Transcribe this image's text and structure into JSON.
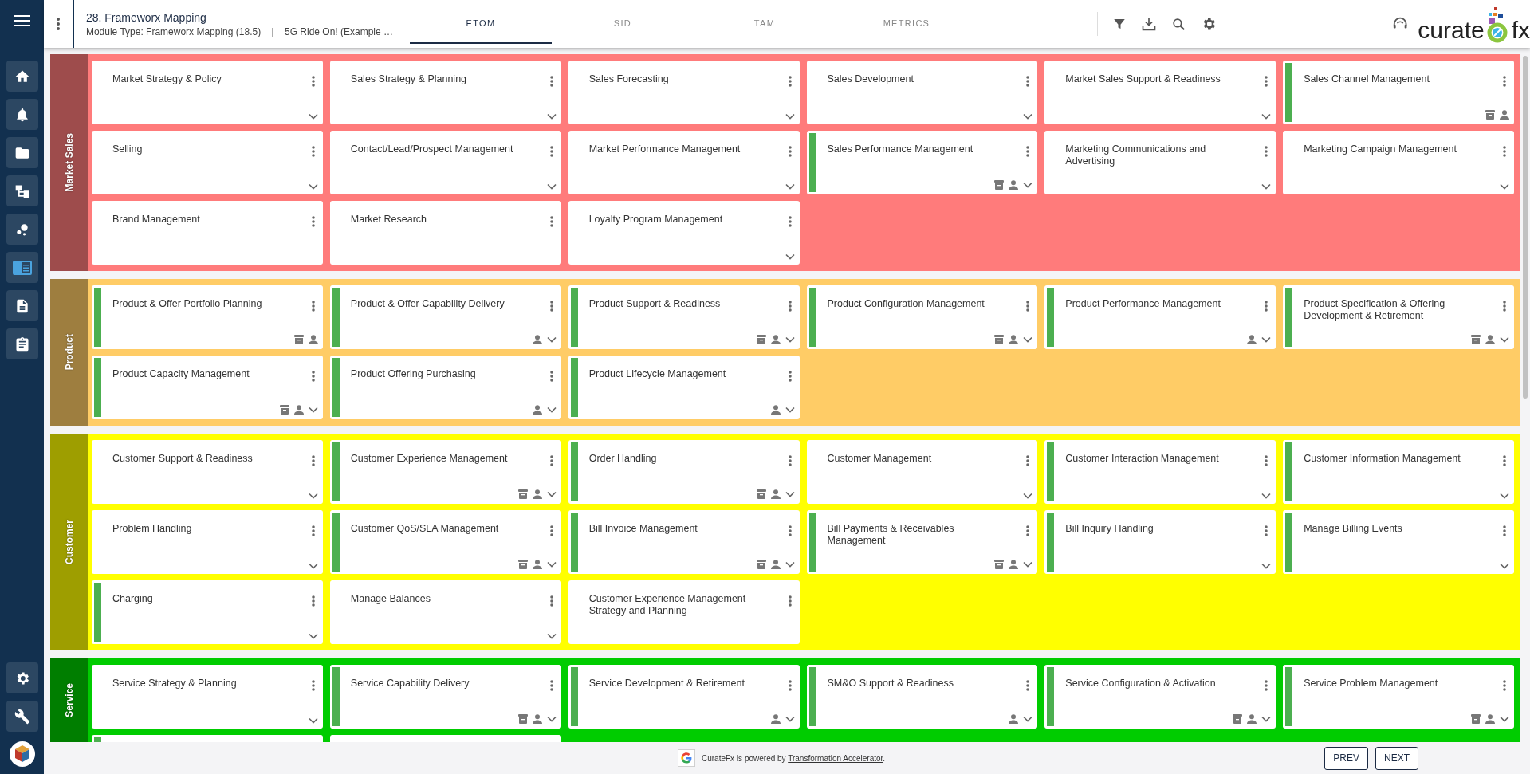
{
  "header": {
    "title": "28. Frameworx Mapping",
    "module_type": "Module Type: Frameworx Mapping (18.5)",
    "separator": "|",
    "project": "5G Ride On! (Example …",
    "logo_text": "curate",
    "logo_suffix": "fx"
  },
  "tabs": [
    {
      "label": "ETOM",
      "selected": true
    },
    {
      "label": "SID",
      "selected": false
    },
    {
      "label": "TAM",
      "selected": false
    },
    {
      "label": "METRICS",
      "selected": false
    }
  ],
  "nav": [
    {
      "selected": false
    },
    {
      "selected": false
    },
    {
      "selected": false
    },
    {
      "selected": false
    },
    {
      "selected": false
    },
    {
      "selected": true
    },
    {
      "selected": false
    },
    {
      "selected": false
    }
  ],
  "sections": [
    {
      "label": "Market Sales",
      "color": "#ff7b7b",
      "cards": [
        {
          "title": "Market Strategy & Policy",
          "mapped": false,
          "archive": false,
          "person": false,
          "expand": true
        },
        {
          "title": "Sales Strategy & Planning",
          "mapped": false,
          "archive": false,
          "person": false,
          "expand": true
        },
        {
          "title": "Sales Forecasting",
          "mapped": false,
          "archive": false,
          "person": false,
          "expand": true
        },
        {
          "title": "Sales Development",
          "mapped": false,
          "archive": false,
          "person": false,
          "expand": true
        },
        {
          "title": "Market Sales Support & Readiness",
          "mapped": false,
          "archive": false,
          "person": false,
          "expand": true
        },
        {
          "title": "Sales Channel Management",
          "mapped": true,
          "archive": true,
          "person": true,
          "expand": false
        },
        {
          "title": "Selling",
          "mapped": false,
          "archive": false,
          "person": false,
          "expand": true
        },
        {
          "title": "Contact/Lead/Prospect Management",
          "mapped": false,
          "archive": false,
          "person": false,
          "expand": true
        },
        {
          "title": "Market Performance Management",
          "mapped": false,
          "archive": false,
          "person": false,
          "expand": true
        },
        {
          "title": "Sales Performance Management",
          "mapped": true,
          "archive": true,
          "person": true,
          "expand": true
        },
        {
          "title": "Marketing Communications and Advertising",
          "mapped": false,
          "archive": false,
          "person": false,
          "expand": true
        },
        {
          "title": "Marketing Campaign Management",
          "mapped": false,
          "archive": false,
          "person": false,
          "expand": true
        },
        {
          "title": "Brand Management",
          "mapped": false,
          "archive": false,
          "person": false,
          "expand": false
        },
        {
          "title": "Market Research",
          "mapped": false,
          "archive": false,
          "person": false,
          "expand": false
        },
        {
          "title": "Loyalty Program Management",
          "mapped": false,
          "archive": false,
          "person": false,
          "expand": true
        }
      ]
    },
    {
      "label": "Product",
      "color": "#ffcc66",
      "cards": [
        {
          "title": "Product & Offer Portfolio Planning",
          "mapped": true,
          "archive": true,
          "person": true,
          "expand": false
        },
        {
          "title": "Product & Offer Capability Delivery",
          "mapped": true,
          "archive": false,
          "person": true,
          "expand": true
        },
        {
          "title": "Product Support & Readiness",
          "mapped": true,
          "archive": true,
          "person": true,
          "expand": true
        },
        {
          "title": "Product Configuration Management",
          "mapped": true,
          "archive": true,
          "person": true,
          "expand": true
        },
        {
          "title": "Product Performance Management",
          "mapped": true,
          "archive": false,
          "person": true,
          "expand": true
        },
        {
          "title": "Product Specification & Offering Development & Retirement",
          "mapped": true,
          "archive": true,
          "person": true,
          "expand": true
        },
        {
          "title": "Product Capacity Management",
          "mapped": true,
          "archive": true,
          "person": true,
          "expand": true
        },
        {
          "title": "Product Offering Purchasing",
          "mapped": true,
          "archive": false,
          "person": true,
          "expand": true
        },
        {
          "title": "Product Lifecycle Management",
          "mapped": true,
          "archive": false,
          "person": true,
          "expand": true
        }
      ]
    },
    {
      "label": "Customer",
      "color": "#ffff00",
      "cards": [
        {
          "title": "Customer Support & Readiness",
          "mapped": false,
          "archive": false,
          "person": false,
          "expand": true
        },
        {
          "title": "Customer Experience Management",
          "mapped": true,
          "archive": true,
          "person": true,
          "expand": true
        },
        {
          "title": "Order Handling",
          "mapped": true,
          "archive": true,
          "person": true,
          "expand": true
        },
        {
          "title": "Customer Management",
          "mapped": false,
          "archive": false,
          "person": false,
          "expand": true
        },
        {
          "title": "Customer Interaction Management",
          "mapped": true,
          "archive": false,
          "person": false,
          "expand": true
        },
        {
          "title": "Customer Information Management",
          "mapped": true,
          "archive": false,
          "person": false,
          "expand": true
        },
        {
          "title": "Problem Handling",
          "mapped": false,
          "archive": false,
          "person": false,
          "expand": true
        },
        {
          "title": "Customer QoS/SLA Management",
          "mapped": true,
          "archive": true,
          "person": true,
          "expand": true
        },
        {
          "title": "Bill Invoice Management",
          "mapped": true,
          "archive": true,
          "person": true,
          "expand": true
        },
        {
          "title": "Bill Payments & Receivables Management",
          "mapped": true,
          "archive": true,
          "person": true,
          "expand": true
        },
        {
          "title": "Bill Inquiry Handling",
          "mapped": true,
          "archive": false,
          "person": false,
          "expand": true
        },
        {
          "title": "Manage Billing Events",
          "mapped": true,
          "archive": false,
          "person": false,
          "expand": true
        },
        {
          "title": "Charging",
          "mapped": true,
          "archive": false,
          "person": false,
          "expand": true
        },
        {
          "title": "Manage Balances",
          "mapped": false,
          "archive": false,
          "person": false,
          "expand": true
        },
        {
          "title": "Customer Experience Management Strategy and Planning",
          "mapped": false,
          "archive": false,
          "person": false,
          "expand": false
        }
      ]
    },
    {
      "label": "Service",
      "color": "#00cc00",
      "cards": [
        {
          "title": "Service Strategy & Planning",
          "mapped": false,
          "archive": false,
          "person": false,
          "expand": true
        },
        {
          "title": "Service Capability Delivery",
          "mapped": true,
          "archive": true,
          "person": true,
          "expand": true
        },
        {
          "title": "Service Development & Retirement",
          "mapped": true,
          "archive": false,
          "person": true,
          "expand": true
        },
        {
          "title": "SM&O Support & Readiness",
          "mapped": true,
          "archive": false,
          "person": true,
          "expand": true
        },
        {
          "title": "Service Configuration & Activation",
          "mapped": true,
          "archive": true,
          "person": true,
          "expand": true
        },
        {
          "title": "Service Problem Management",
          "mapped": true,
          "archive": true,
          "person": true,
          "expand": true
        },
        {
          "mapped": true
        },
        {
          "mapped": false
        }
      ]
    }
  ],
  "footer": {
    "text_before": "CurateFx is powered by",
    "link": "Transformation Accelerator",
    "text_after": ".",
    "buttons": [
      "PREV",
      "NEXT"
    ]
  }
}
